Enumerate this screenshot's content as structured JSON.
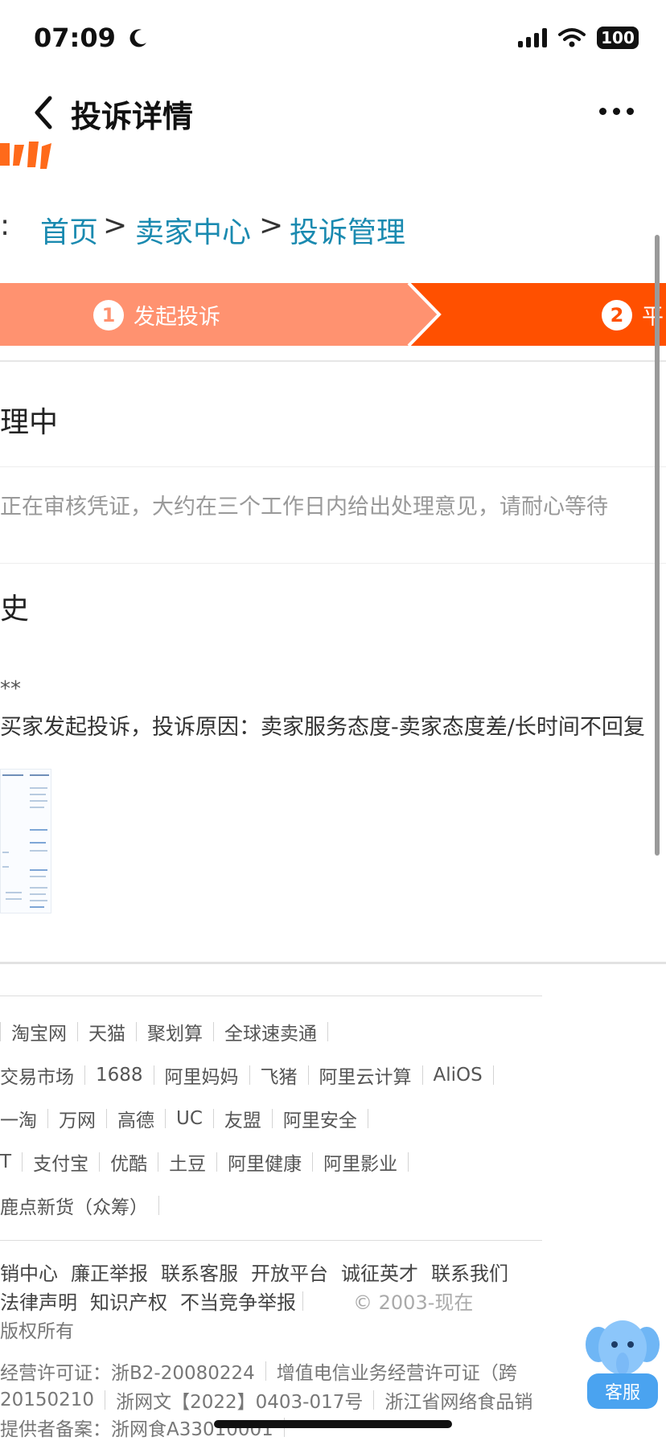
{
  "status_bar": {
    "time": "07:09",
    "battery": "100"
  },
  "nav": {
    "title": "投诉详情"
  },
  "breadcrumb": {
    "colon": ":",
    "items": [
      "首页",
      "卖家中心",
      "投诉管理"
    ],
    "separator": ">"
  },
  "steps": [
    {
      "num": "1",
      "label": "发起投诉"
    },
    {
      "num": "2",
      "label": "平"
    }
  ],
  "status": {
    "heading": "理中",
    "description": "正在审核凭证，大约在三个工作日内给出处理意见，请耐心等待"
  },
  "history": {
    "heading": "史",
    "user": "**",
    "description": "买家发起投诉，投诉原因：卖家服务态度-卖家态度差/长时间不回复"
  },
  "footer": {
    "links_row1": [
      "淘宝网",
      "天猫",
      "聚划算",
      "全球速卖通"
    ],
    "links_row2": [
      "交易市场",
      "1688",
      "阿里妈妈",
      "飞猪",
      "阿里云计算",
      "AliOS"
    ],
    "links_row3": [
      "一淘",
      "万网",
      "高德",
      "UC",
      "友盟",
      "阿里安全"
    ],
    "links_row4": [
      "T",
      "支付宝",
      "优酷",
      "土豆",
      "阿里健康",
      "阿里影业"
    ],
    "links_row5": [
      "鹿点新货（众筹）"
    ],
    "about_row1": [
      "销中心",
      "廉正举报",
      "联系客服",
      "开放平台",
      "诚征英才",
      "联系我们"
    ],
    "about_row2": [
      "法律声明",
      "知识产权",
      "不当竞争举报"
    ],
    "copyright": "© 2003-现在",
    "rights": "版权所有",
    "license_row1": [
      "经营许可证：浙B2-20080224",
      "增值电信业务经营许可证（跨"
    ],
    "license_row2": [
      "20150210",
      "浙网文【2022】0403-017号",
      "浙江省网络食品销"
    ],
    "license_row3": "提供者备案：浙网食A33010001"
  },
  "customer_service": {
    "label": "客服"
  },
  "colors": {
    "accent": "#ff5000",
    "step_done": "#ff9270",
    "link": "#1a8ab0"
  }
}
